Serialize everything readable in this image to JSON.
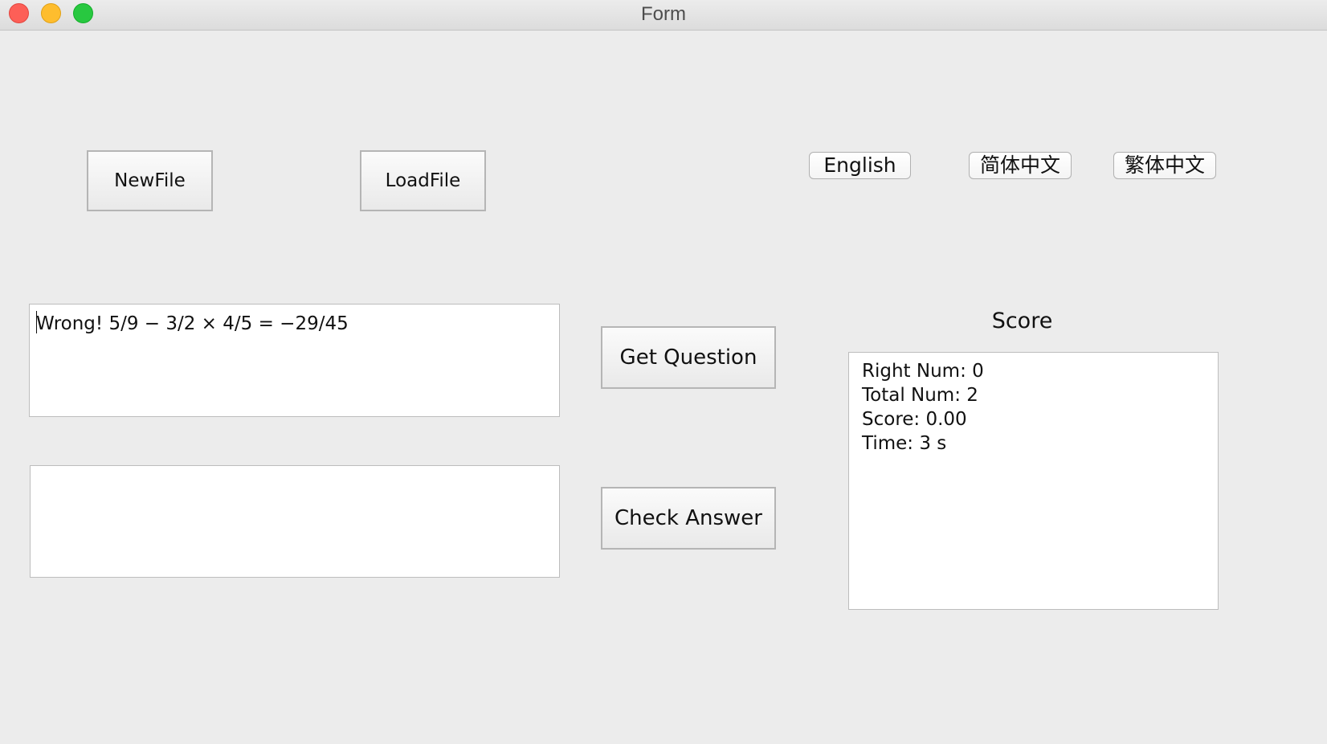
{
  "window": {
    "title": "Form"
  },
  "toolbar": {
    "new_file_label": "NewFile",
    "load_file_label": "LoadFile"
  },
  "language": {
    "english_label": "English",
    "simplified_chinese_label": "简体中文",
    "traditional_chinese_label": "繁体中文"
  },
  "question": {
    "text": "Wrong! 5/9 − 3/2 × 4/5 = −29/45"
  },
  "answer": {
    "value": ""
  },
  "actions": {
    "get_question_label": "Get Question",
    "check_answer_label": "Check Answer"
  },
  "score": {
    "heading": "Score",
    "lines": [
      "Right Num: 0",
      "Total Num: 2",
      "Score: 0.00",
      "Time: 3 s"
    ]
  }
}
